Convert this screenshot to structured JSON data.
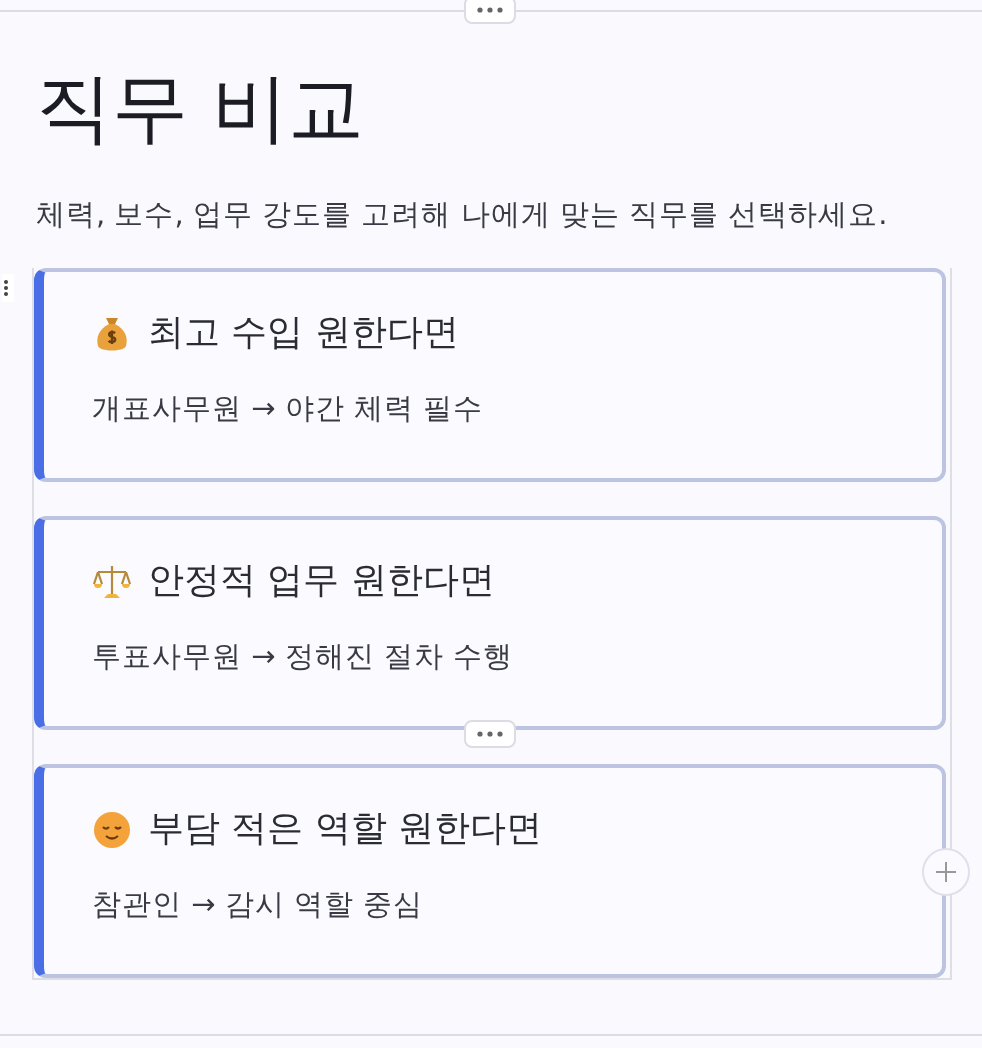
{
  "title": "직무 비교",
  "subtitle": "체력, 보수, 업무 강도를 고려해 나에게 맞는 직무를 선택하세요.",
  "cards": [
    {
      "heading": "최고 수입 원한다면",
      "detail": "개표사무원 → 야간 체력 필수"
    },
    {
      "heading": "안정적 업무 원한다면",
      "detail": "투표사무원 → 정해진 절차 수행"
    },
    {
      "heading": "부담 적은 역할 원한다면",
      "detail": "참관인 → 감시 역할 중심"
    }
  ]
}
